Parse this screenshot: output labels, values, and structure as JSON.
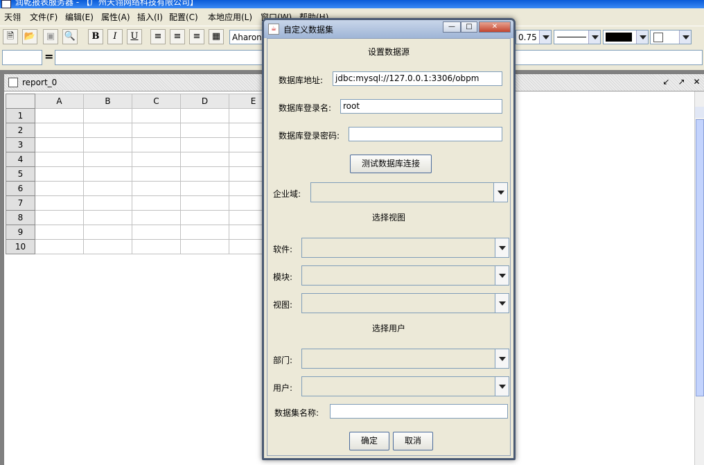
{
  "main_window": {
    "title": "润乾报表服务器 - 【广州天翎网络科技有限公司】"
  },
  "menubar": {
    "items": [
      "天翎",
      "文件(F)",
      "编辑(E)",
      "属性(A)",
      "插入(I)",
      "配置(C)",
      "本地应用(L)",
      "窗口(W)",
      "帮助(H)"
    ]
  },
  "toolbar": {
    "bold": "B",
    "italic": "I",
    "underline": "U",
    "font_value": "Aharoni",
    "line_width_value": "0.75"
  },
  "formula_bar": {
    "equals": "="
  },
  "report_window": {
    "title": "report_0"
  },
  "sheet": {
    "columns": [
      "A",
      "B",
      "C",
      "D",
      "E"
    ],
    "rows": [
      "1",
      "2",
      "3",
      "4",
      "5",
      "6",
      "7",
      "8",
      "9",
      "10"
    ]
  },
  "dialog": {
    "title": "自定义数据集",
    "section_datasource": "设置数据源",
    "db_url_label": "数据库地址:",
    "db_url_value": "jdbc:mysql://127.0.0.1:3306/obpm",
    "db_user_label": "数据库登录名:",
    "db_user_value": "root",
    "db_password_label": "数据库登录密码:",
    "db_password_value": "",
    "test_button": "测试数据库连接",
    "domain_label": "企业域:",
    "section_view": "选择视图",
    "software_label": "软件:",
    "module_label": "模块:",
    "view_label": "视图:",
    "section_user": "选择用户",
    "department_label": "部门:",
    "user_label": "用户:",
    "dataset_name_label": "数据集名称:",
    "dataset_name_value": "",
    "ok_button": "确定",
    "cancel_button": "取消"
  },
  "colors": {
    "titlebar": "#0a5bd8",
    "dialog_frame": "#4a5a73",
    "workspace": "#808080"
  }
}
